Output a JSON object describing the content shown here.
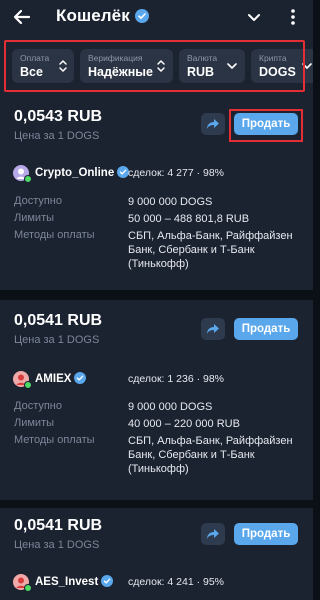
{
  "header": {
    "title": "Кошелёк"
  },
  "filters": [
    {
      "label": "Оплата",
      "value": "Все"
    },
    {
      "label": "Верификация",
      "value": "Надёжные"
    },
    {
      "label": "Валюта",
      "value": "RUB"
    },
    {
      "label": "Крипта",
      "value": "DOGS"
    }
  ],
  "common": {
    "price_caption": "Цена за 1 DOGS",
    "sell_label": "Продать",
    "available_label": "Доступно",
    "limits_label": "Лимиты",
    "methods_label": "Методы оплаты"
  },
  "offers": [
    {
      "price": "0,0543 RUB",
      "merchant": "Crypto_Online",
      "stats": "сделок: 4 277 · 98%",
      "available": "9 000 000 DOGS",
      "limits": "50 000 – 488 801,8 RUB",
      "methods_line1": "СБП, Альфа-Банк, Райффайзен",
      "methods_line2": "Банк, Сбербанк и Т-Банк",
      "methods_line3": "(Тинькофф)"
    },
    {
      "price": "0,0541 RUB",
      "merchant": "AMIEX",
      "stats": "сделок: 1 236 · 98%",
      "available": "9 000 000 DOGS",
      "limits": "40 000 – 220 000 RUB",
      "methods_line1": "СБП, Альфа-Банк, Райффайзен",
      "methods_line2": "Банк, Сбербанк и Т-Банк",
      "methods_line3": "(Тинькофф)"
    },
    {
      "price": "0,0541 RUB",
      "merchant": "AES_Invest",
      "stats": "сделок: 4 241 · 95%"
    }
  ],
  "colors": {
    "background": "#0b0f16",
    "card": "#1b2230",
    "chip": "#2b3444",
    "accent": "#5aa7ec",
    "highlight": "#e32e35",
    "online": "#4cd964"
  },
  "icons": [
    "back-arrow-icon",
    "verified-badge-icon",
    "chevron-down-icon",
    "more-vertical-icon",
    "sort-icon",
    "share-icon"
  ]
}
